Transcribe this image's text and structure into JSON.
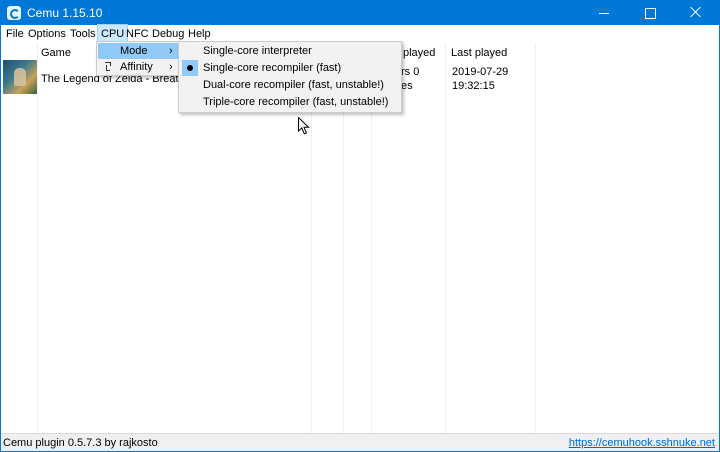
{
  "window": {
    "title": "Cemu 1.15.10"
  },
  "menubar": {
    "items": [
      "File",
      "Options",
      "Tools",
      "CPU",
      "NFC",
      "Debug",
      "Help"
    ],
    "active": "CPU"
  },
  "list": {
    "headers": {
      "game": "Game",
      "time_played": "played",
      "last_played": "Last played"
    },
    "rows": [
      {
        "title": "The Legend of Zelda - Breath of",
        "time_played_line1": "rs 0",
        "time_played_line2": "es",
        "last_played_date": "2019-07-29",
        "last_played_time": "19:32:15"
      }
    ]
  },
  "cpu_menu": {
    "items": [
      {
        "label": "Mode",
        "icon": "none",
        "submenu_arrow": "›",
        "highlighted": true
      },
      {
        "label": "Affinity",
        "icon": "affinity-icon",
        "submenu_arrow": "›",
        "highlighted": false
      }
    ]
  },
  "mode_submenu": {
    "items": [
      {
        "label": "Single-core interpreter",
        "checked": false
      },
      {
        "label": "Single-core recompiler (fast)",
        "checked": true
      },
      {
        "label": "Dual-core recompiler (fast, unstable!)",
        "checked": false
      },
      {
        "label": "Triple-core recompiler (fast, unstable!)",
        "checked": false
      }
    ]
  },
  "statusbar": {
    "left_text": "Cemu plugin 0.5.7.3 by rajkosto",
    "link_text": "https://cemuhook.sshnuke.net"
  },
  "colors": {
    "titlebar": "#0078d7",
    "menu_highlight": "#91c9f7",
    "link": "#0066cc"
  }
}
